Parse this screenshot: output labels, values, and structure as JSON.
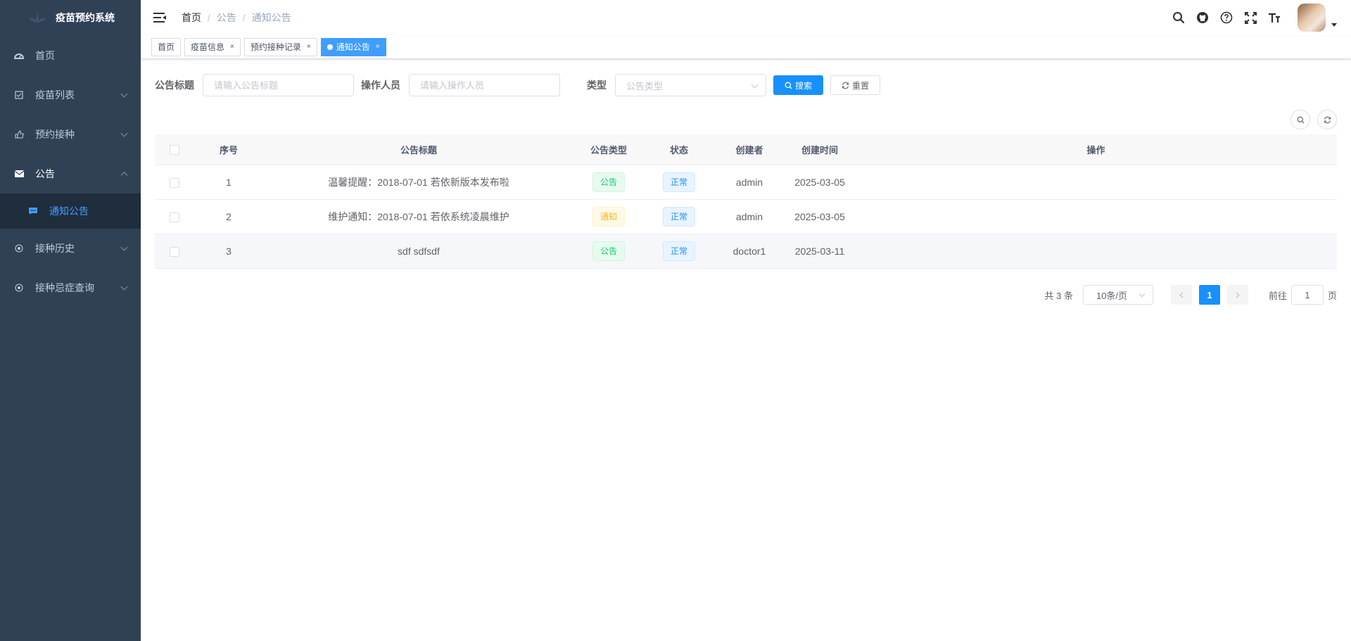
{
  "app": {
    "title": "疫苗预约系统"
  },
  "sidebar": {
    "items": [
      {
        "label": "首页"
      },
      {
        "label": "疫苗列表"
      },
      {
        "label": "预约接种"
      },
      {
        "label": "公告"
      },
      {
        "label": "接种历史"
      },
      {
        "label": "接种忌症查询"
      }
    ],
    "subitem": {
      "label": "通知公告"
    }
  },
  "breadcrumb": [
    "首页",
    "公告",
    "通知公告"
  ],
  "tags": [
    "首页",
    "疫苗信息",
    "预约接种记录",
    "通知公告"
  ],
  "form": {
    "title_label": "公告标题",
    "title_placeholder": "请输入公告标题",
    "operator_label": "操作人员",
    "operator_placeholder": "请输入操作人员",
    "type_label": "类型",
    "type_placeholder": "公告类型",
    "search_label": "搜索",
    "reset_label": "重置"
  },
  "table": {
    "headers": [
      "序号",
      "公告标题",
      "公告类型",
      "状态",
      "创建者",
      "创建时间",
      "操作"
    ],
    "rows": [
      {
        "id": "1",
        "title": "温馨提醒：2018-07-01 若依新版本发布啦",
        "type": "公告",
        "status": "正常",
        "creator": "admin",
        "time": "2025-03-05"
      },
      {
        "id": "2",
        "title": "维护通知：2018-07-01 若依系统凌晨维护",
        "type": "通知",
        "status": "正常",
        "creator": "admin",
        "time": "2025-03-05"
      },
      {
        "id": "3",
        "title": "sdf sdfsdf",
        "type": "公告",
        "status": "正常",
        "creator": "doctor1",
        "time": "2025-03-11"
      }
    ]
  },
  "pagination": {
    "total": "共 3 条",
    "page_size": "10条/页",
    "current": "1",
    "goto_label": "前往",
    "goto_value": "1",
    "page_suffix": "页"
  },
  "colors": {
    "sidebar_bg": "#304156",
    "primary": "#1890ff",
    "active_menu": "#409eff"
  }
}
